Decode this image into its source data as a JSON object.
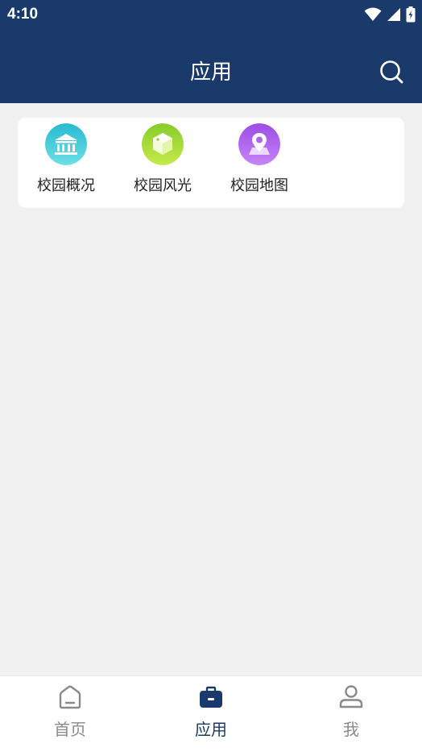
{
  "status_bar": {
    "time": "4:10",
    "icons": [
      "wifi-icon",
      "cellular-signal-icon",
      "battery-charging-icon"
    ]
  },
  "app_bar": {
    "title": "应用",
    "action_icon": "search-icon"
  },
  "apps": [
    {
      "label": "校园概况",
      "icon": "campus-building-icon",
      "color": "#3cc6d6"
    },
    {
      "label": "校园风光",
      "icon": "cube-icon",
      "color": "#8fd13a"
    },
    {
      "label": "校园地图",
      "icon": "map-pin-icon",
      "color": "#a45cf0"
    }
  ],
  "bottom_nav": {
    "items": [
      {
        "label": "首页",
        "icon": "home-icon",
        "active": false
      },
      {
        "label": "应用",
        "icon": "briefcase-icon",
        "active": true
      },
      {
        "label": "我",
        "icon": "person-icon",
        "active": false
      }
    ],
    "active_color": "#1a3a6b",
    "inactive_color": "#8a8a8a"
  },
  "colors": {
    "header_bg": "#1a3a6b",
    "page_bg": "#f1f1f1",
    "card_bg": "#ffffff"
  }
}
